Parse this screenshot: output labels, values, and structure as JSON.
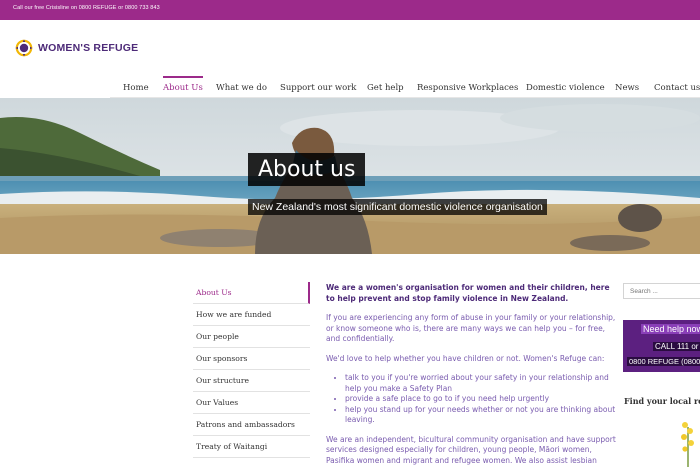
{
  "topbar": {
    "crisisline": "Call our free Crisisline on 0800 REFUGE or 0800 733 843"
  },
  "brand": {
    "name": "WOMEN'S REFUGE"
  },
  "nav": {
    "items": [
      {
        "label": "Home"
      },
      {
        "label": "About Us"
      },
      {
        "label": "What we do"
      },
      {
        "label": "Support our work"
      },
      {
        "label": "Get help"
      },
      {
        "label": "Responsive Workplaces"
      },
      {
        "label": "Domestic violence"
      },
      {
        "label": "News"
      },
      {
        "label": "Contact us"
      }
    ],
    "active": "About Us"
  },
  "hero": {
    "title": "About us",
    "subtitle": "New Zealand's most significant domestic violence organisation"
  },
  "sidebar": {
    "items": [
      {
        "label": "About Us"
      },
      {
        "label": "How we are funded"
      },
      {
        "label": "Our people"
      },
      {
        "label": "Our sponsors"
      },
      {
        "label": "Our structure"
      },
      {
        "label": "Our Values"
      },
      {
        "label": "Patrons and ambassadors"
      },
      {
        "label": "Treaty of Waitangi"
      }
    ],
    "active": "About Us"
  },
  "content": {
    "lead": "We are a women's organisation for women and their children, here to help prevent and stop family violence in New Zealand.",
    "p1": "If you are experiencing any form of abuse in your family or your relationship, or know someone who is, there are many ways we can help you – for free, and confidentially.",
    "p2": "We'd love to help whether you have children or not. Women's Refuge can:",
    "bullets": [
      "talk to you if you're worried about your safety in your relationship and help you make a Safety Plan",
      "provide a safe place to go to if you need help urgently",
      "help you stand up for your needs whether or not you are thinking about leaving."
    ],
    "p3": "We are an independent, bicultural community organisation and have support services designed especially for children, young people, Māori women, Pasifika women and migrant and refugee women. We also assist lesbian women, older"
  },
  "right": {
    "search_placeholder": "Search ...",
    "banner_line1": "Need help now",
    "banner_line2": "CALL 111 or",
    "banner_line3": "0800 REFUGE (0800",
    "find_heading": "Find your local refu"
  },
  "colors": {
    "brand_purple": "#9c2a8a",
    "deep_purple": "#4d2a78",
    "text_purple": "#7a5caf"
  }
}
